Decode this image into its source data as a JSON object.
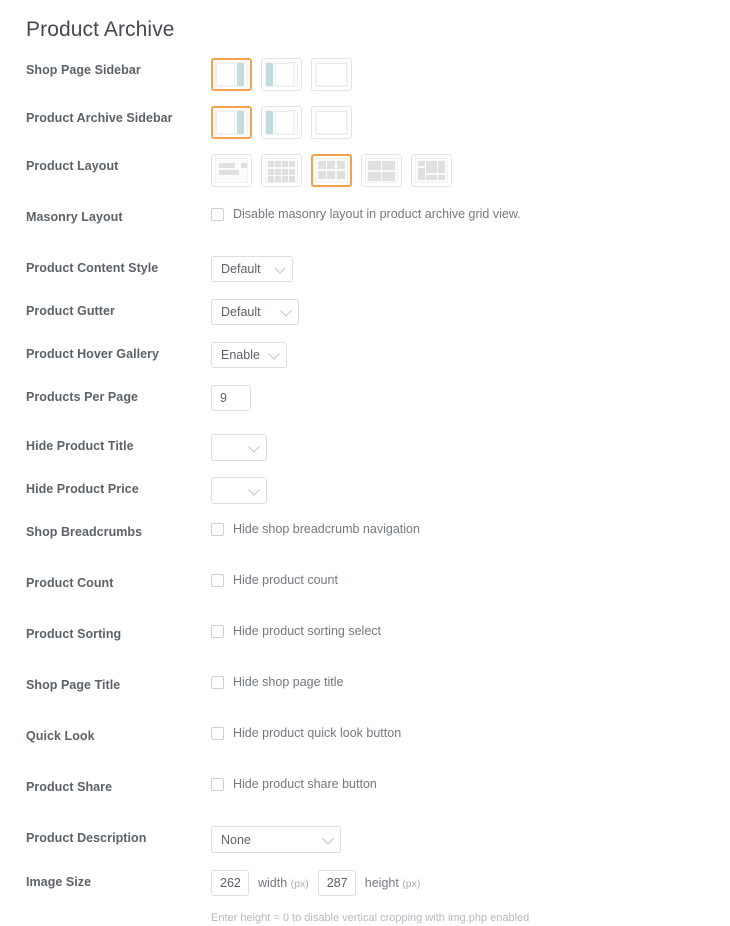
{
  "page": {
    "title": "Product Archive"
  },
  "colors": {
    "accent_selected": "#f3a24a",
    "sidebar_block": "#c3dbe1",
    "label_text": "#5b6268",
    "muted_text": "#73797f",
    "helper_text": "#b5babf",
    "border": "#dedede"
  },
  "rows": {
    "shop_page_sidebar": {
      "label": "Shop Page Sidebar",
      "options": [
        {
          "name": "sidebar-right",
          "selected": true
        },
        {
          "name": "sidebar-left",
          "selected": false
        },
        {
          "name": "sidebar-none",
          "selected": false
        }
      ]
    },
    "product_archive_sidebar": {
      "label": "Product Archive Sidebar",
      "options": [
        {
          "name": "sidebar-right",
          "selected": true
        },
        {
          "name": "sidebar-left",
          "selected": false
        },
        {
          "name": "sidebar-none",
          "selected": false
        }
      ]
    },
    "product_layout": {
      "label": "Product Layout",
      "options": [
        {
          "name": "layout-list",
          "selected": false
        },
        {
          "name": "layout-grid-4-col",
          "selected": false
        },
        {
          "name": "layout-grid-3-col",
          "selected": true
        },
        {
          "name": "layout-grid-2-col",
          "selected": false
        },
        {
          "name": "layout-masonry",
          "selected": false
        }
      ]
    },
    "masonry_layout": {
      "label": "Masonry Layout",
      "checkbox_label": "Disable masonry layout in product archive grid view.",
      "checked": false
    },
    "product_content_style": {
      "label": "Product Content Style",
      "value": "Default"
    },
    "product_gutter": {
      "label": "Product Gutter",
      "value": "Default"
    },
    "product_hover_gallery": {
      "label": "Product Hover Gallery",
      "value": "Enable"
    },
    "products_per_page": {
      "label": "Products Per Page",
      "value": "9"
    },
    "hide_product_title": {
      "label": "Hide Product Title",
      "value": ""
    },
    "hide_product_price": {
      "label": "Hide Product Price",
      "value": ""
    },
    "shop_breadcrumbs": {
      "label": "Shop Breadcrumbs",
      "checkbox_label": "Hide shop breadcrumb navigation",
      "checked": false
    },
    "product_count": {
      "label": "Product Count",
      "checkbox_label": "Hide product count",
      "checked": false
    },
    "product_sorting": {
      "label": "Product Sorting",
      "checkbox_label": "Hide product sorting select",
      "checked": false
    },
    "shop_page_title": {
      "label": "Shop Page Title",
      "checkbox_label": "Hide shop page title",
      "checked": false
    },
    "quick_look": {
      "label": "Quick Look",
      "checkbox_label": "Hide product quick look button",
      "checked": false
    },
    "product_share": {
      "label": "Product Share",
      "checkbox_label": "Hide product share button",
      "checked": false
    },
    "product_description": {
      "label": "Product Description",
      "value": "None"
    },
    "image_size": {
      "label": "Image Size",
      "width_value": "262",
      "width_label": "width",
      "width_unit": "(px)",
      "height_value": "287",
      "height_label": "height",
      "height_unit": "(px)",
      "helper": "Enter height = 0 to disable vertical cropping with img.php enabled"
    }
  }
}
